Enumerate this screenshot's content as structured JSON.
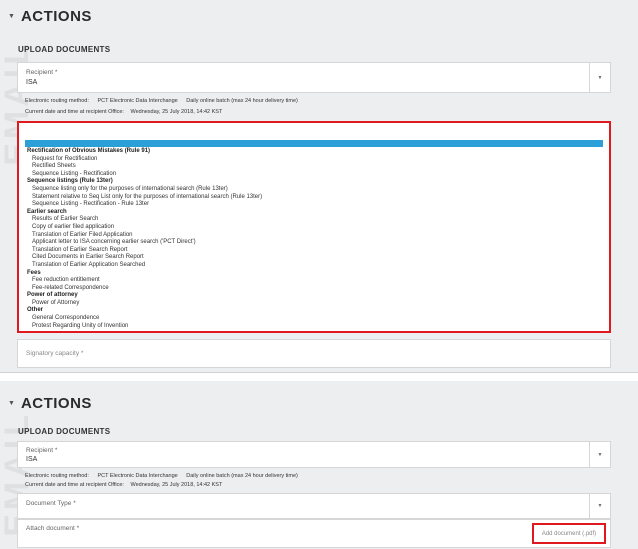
{
  "panel1": {
    "watermark": "EMAIL",
    "section_title": "ACTIONS",
    "sub_title": "UPLOAD DOCUMENTS",
    "recipient": {
      "label": "Recipient *",
      "value": "ISA"
    },
    "routing": {
      "label": "Electronic routing method:",
      "method": "PCT Electronic Data Interchange",
      "batch": "Daily online batch (max 24 hour delivery time)"
    },
    "datetime": {
      "label": "Current date and time at recipient Office:",
      "value": "Wednesday, 25 July 2018, 14:42 KST"
    },
    "dropdown_groups": [
      {
        "label": "Rectification of Obvious Mistakes (Rule 91)",
        "options": [
          "Request for Rectification",
          "Rectified Sheets",
          "Sequence Listing - Rectification"
        ]
      },
      {
        "label": "Sequence listings (Rule 13ter)",
        "options": [
          "Sequence listing only for the purposes of international search (Rule 13ter)",
          "Statement relative to Seq List only for the purposes of international search (Rule 13ter)",
          "Sequence Listing - Rectification - Rule 13ter"
        ]
      },
      {
        "label": "Earlier search",
        "options": [
          "Results of Earlier Search",
          "Copy of earlier filed application",
          "Translation of Earlier Filed Application",
          "Applicant letter to ISA concerning earlier search ('PCT Direct')",
          "Translation of Earlier Search Report",
          "Cited Documents in Earlier Search Report",
          "Translation of Earlier Application Searched"
        ]
      },
      {
        "label": "Fees",
        "options": [
          "Fee reduction entitlement",
          "Fee-related Correspondence"
        ]
      },
      {
        "label": "Power of attorney",
        "options": [
          "Power of Attorney"
        ]
      },
      {
        "label": "Other",
        "options": [
          "General Correspondence",
          "Protest Regarding Unity of Invention"
        ]
      }
    ],
    "signatory": {
      "label": "Signatory capacity *"
    }
  },
  "panel2": {
    "watermark": "EMAIL",
    "section_title": "ACTIONS",
    "sub_title": "UPLOAD DOCUMENTS",
    "recipient": {
      "label": "Recipient *",
      "value": "ISA"
    },
    "routing": {
      "label": "Electronic routing method:",
      "method": "PCT Electronic Data Interchange",
      "batch": "Daily online batch (max 24 hour delivery time)"
    },
    "datetime": {
      "label": "Current date and time at recipient Office:",
      "value": "Wednesday, 25 July 2018, 14:42 KST"
    },
    "document_type": {
      "label": "Document Type *"
    },
    "attach_document": {
      "label": "Attach document *",
      "button": "Add document (.pdf)"
    }
  },
  "colors": {
    "highlight_border": "#e0191f",
    "selected_option": "#2a9fd8",
    "panel_bg": "#eceeef"
  }
}
